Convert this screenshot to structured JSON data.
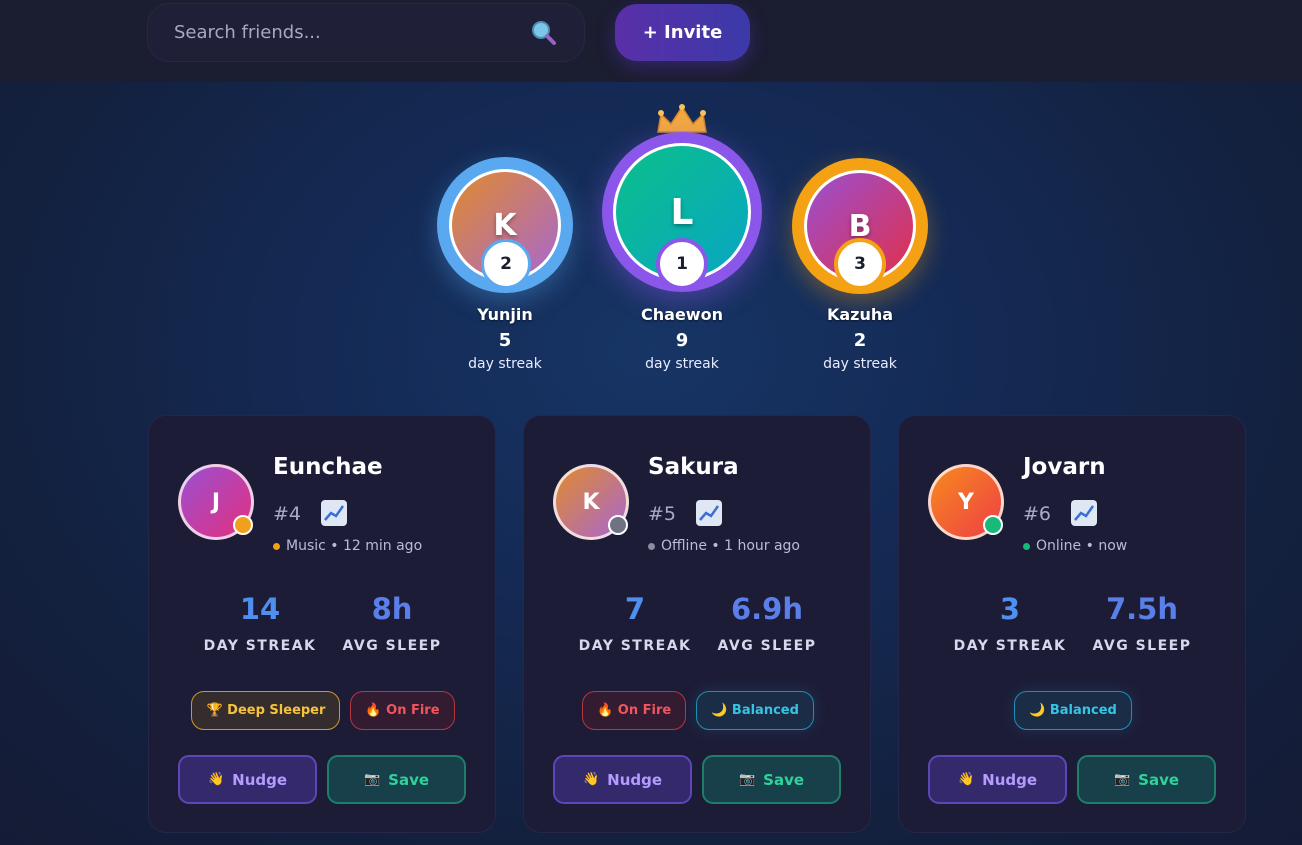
{
  "search": {
    "placeholder": "Search friends...",
    "icon": "search-icon"
  },
  "invite_label": "+ Invite",
  "podium": [
    {
      "rank": "2",
      "initial": "K",
      "name": "Yunjin",
      "streak": "5",
      "unit": "day streak",
      "ring_color": "#5aa8f0",
      "avatar_gradient": [
        "#e08a2e",
        "#a867d0"
      ]
    },
    {
      "rank": "1",
      "initial": "L",
      "name": "Chaewon",
      "streak": "9",
      "unit": "day streak",
      "ring_color": "#8a57ea",
      "avatar_gradient": [
        "#0bbf8a",
        "#08a6c4"
      ]
    },
    {
      "rank": "3",
      "initial": "B",
      "name": "Kazuha",
      "streak": "2",
      "unit": "day streak",
      "ring_color": "#f4a114",
      "avatar_gradient": [
        "#9b4fd2",
        "#e0304a"
      ]
    }
  ],
  "cards": [
    {
      "initial": "J",
      "name": "Eunchae",
      "rank": "#4",
      "status_text": "Music • 12 min ago",
      "status_color": "#f0a01a",
      "avatar_gradient": [
        "#9b4fd2",
        "#e3307e"
      ],
      "dot_color": "#f0a01a",
      "streak": "14",
      "streak_label": "DAY STREAK",
      "sleep": "8h",
      "sleep_label": "AVG SLEEP",
      "badges": [
        {
          "label": "Deep Sleeper",
          "icon": "trophy-icon",
          "type": "gold"
        },
        {
          "label": "On Fire",
          "icon": "fire-icon",
          "type": "fire"
        }
      ],
      "nudge_label": "Nudge",
      "save_label": "Save"
    },
    {
      "initial": "K",
      "name": "Sakura",
      "rank": "#5",
      "status_text": "Offline • 1 hour ago",
      "status_color": "#8a8ca0",
      "avatar_gradient": [
        "#e08a2e",
        "#a867d0"
      ],
      "dot_color": "#6e7282",
      "streak": "7",
      "streak_label": "DAY STREAK",
      "sleep": "6.9h",
      "sleep_label": "AVG SLEEP",
      "badges": [
        {
          "label": "On Fire",
          "icon": "fire-icon",
          "type": "fire"
        },
        {
          "label": "Balanced",
          "icon": "moon-icon",
          "type": "balanced"
        }
      ],
      "nudge_label": "Nudge",
      "save_label": "Save"
    },
    {
      "initial": "Y",
      "name": "Jovarn",
      "rank": "#6",
      "status_text": "Online • now",
      "status_color": "#18b97a",
      "avatar_gradient": [
        "#f68a1e",
        "#ee3e46"
      ],
      "dot_color": "#18b97a",
      "streak": "3",
      "streak_label": "DAY STREAK",
      "sleep": "7.5h",
      "sleep_label": "AVG SLEEP",
      "badges": [
        {
          "label": "Balanced",
          "icon": "moon-icon",
          "type": "balanced"
        }
      ],
      "nudge_label": "Nudge",
      "save_label": "Save"
    }
  ]
}
